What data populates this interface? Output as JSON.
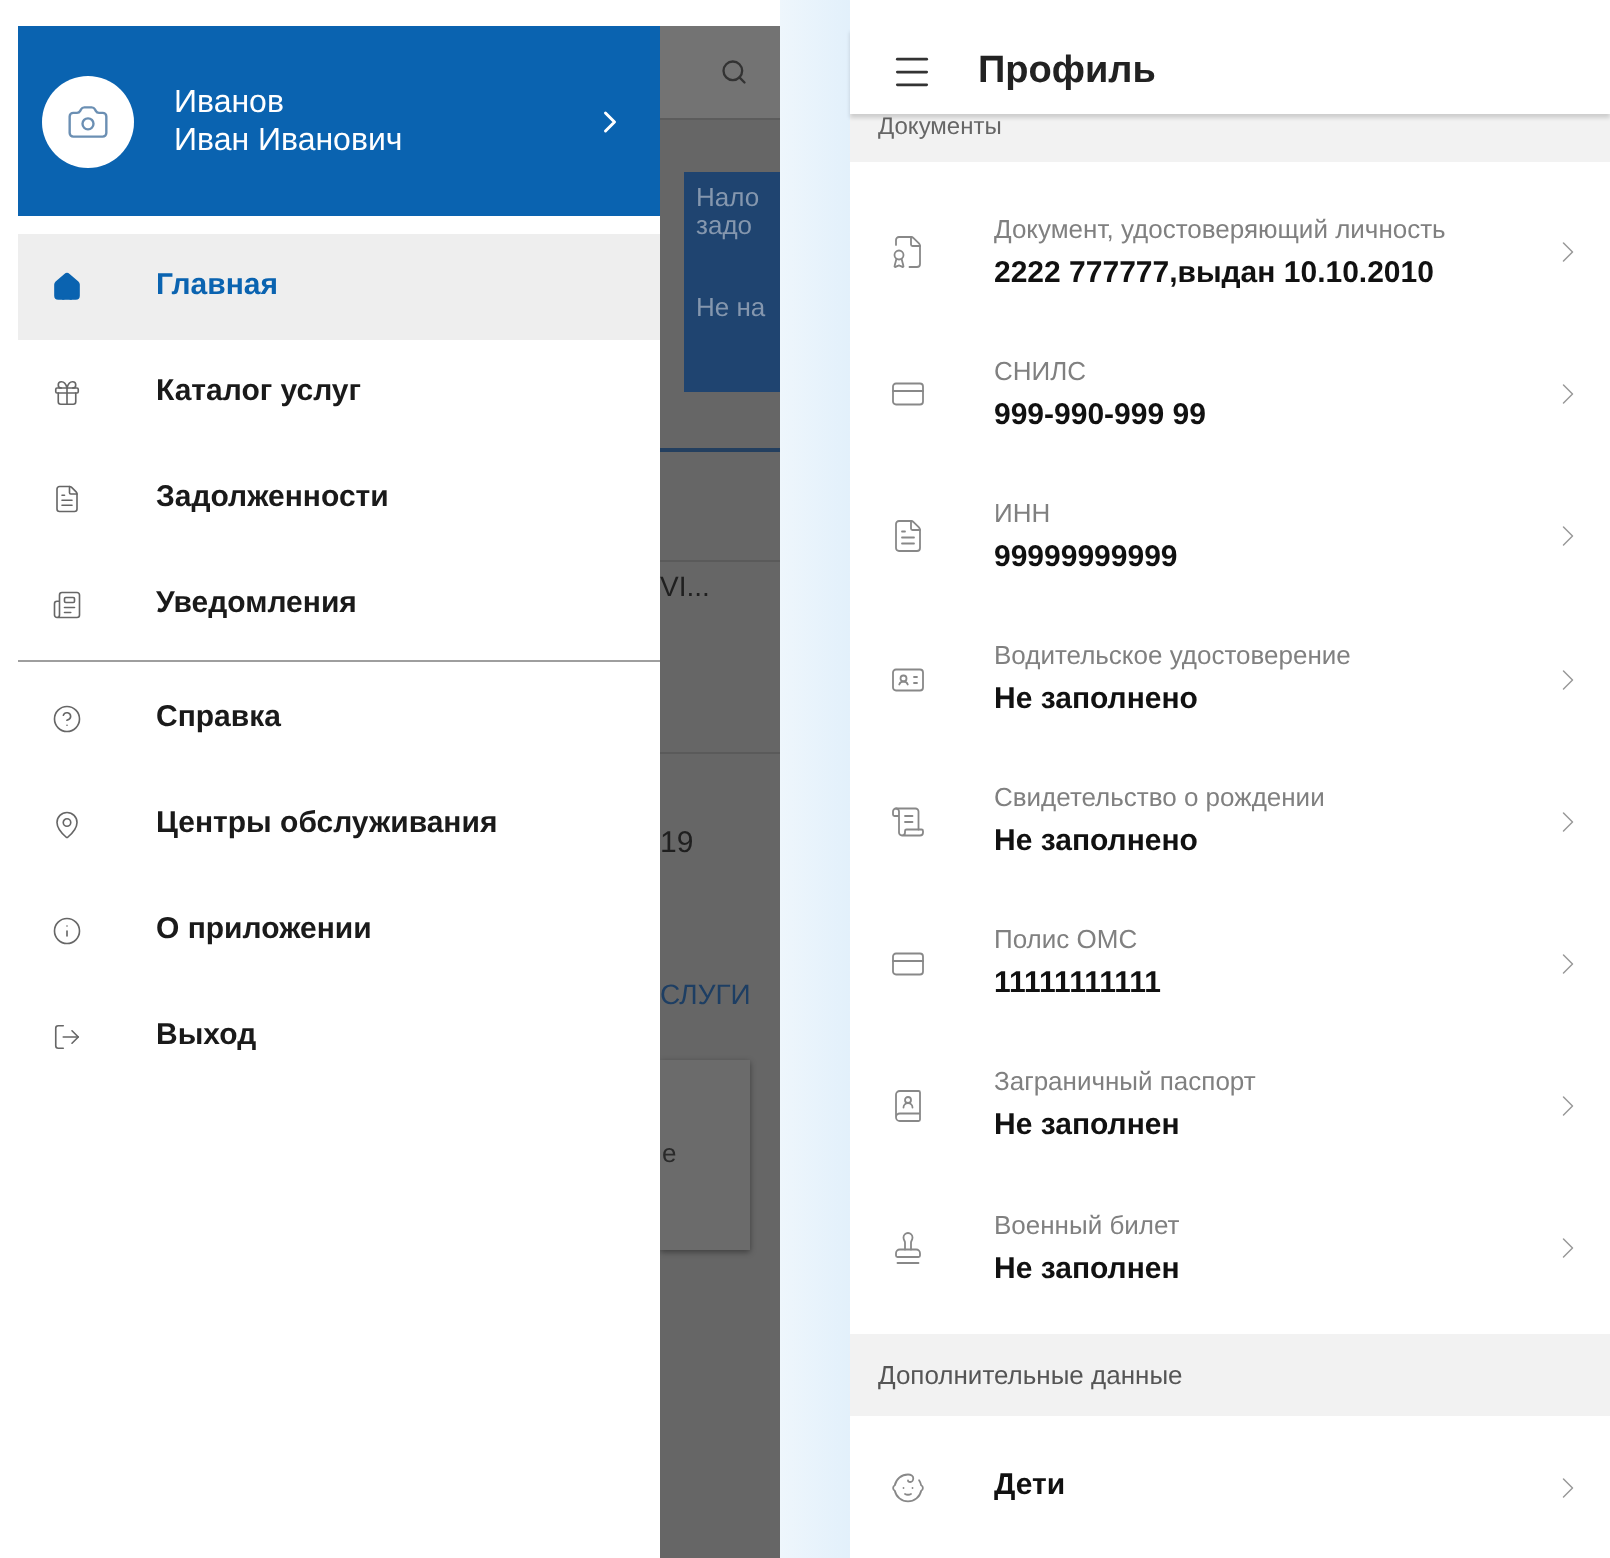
{
  "drawer": {
    "user": {
      "last_name": "Иванов",
      "first_names": "Иван Иванович"
    },
    "menu_sections": [
      [
        {
          "label": "Главная",
          "selected": true
        },
        {
          "label": "Каталог услуг",
          "selected": false
        },
        {
          "label": "Задолженности",
          "selected": false
        },
        {
          "label": "Уведомления",
          "selected": false
        }
      ],
      [
        {
          "label": "Справка",
          "selected": false
        },
        {
          "label": "Центры обслуживания",
          "selected": false
        },
        {
          "label": "О приложении",
          "selected": false
        },
        {
          "label": "Выход",
          "selected": false
        }
      ]
    ]
  },
  "background_fragments": {
    "card_title_1": "Нало",
    "card_title_2": "задо",
    "card_status": "Не на",
    "row_text": "VI...",
    "date_text": "19",
    "link_text": "СЛУГИ",
    "card_text": "е"
  },
  "profile": {
    "title": "Профиль",
    "section": "Документы",
    "documents": [
      {
        "label": "Документ, удостоверяющий личность",
        "value": "2222 777777,выдан 10.10.2010"
      },
      {
        "label": "СНИЛС",
        "value": "999-990-999 99"
      },
      {
        "label": "ИНН",
        "value": "99999999999"
      },
      {
        "label": "Водительское удостоверение",
        "value": "Не заполнено"
      },
      {
        "label": "Свидетельство о рождении",
        "value": "Не заполнено"
      },
      {
        "label": "Полис ОМС",
        "value": "11111111111"
      },
      {
        "label": "Заграничный паспорт",
        "value": "Не заполнен"
      },
      {
        "label": "Военный билет",
        "value": "Не заполнен"
      }
    ],
    "extra_section": "Дополнительные данные",
    "extra_items": [
      {
        "label": "Дети"
      }
    ]
  }
}
